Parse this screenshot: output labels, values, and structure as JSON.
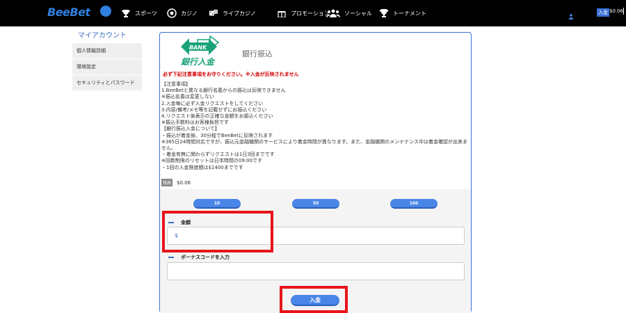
{
  "header": {
    "logo_text": "BeeBet",
    "nav": [
      {
        "label": "スポーツ",
        "icon": "trophy-icon"
      },
      {
        "label": "カジノ",
        "icon": "poker-chip-icon"
      },
      {
        "label": "ライブカジノ",
        "icon": "dice-icon"
      },
      {
        "label": "プロモーション",
        "icon": "gift-icon"
      },
      {
        "label": "ソーシャル",
        "icon": "users-icon"
      },
      {
        "label": "トーナメント",
        "icon": "cup-icon"
      }
    ],
    "balance_badge": "入金",
    "balance_value": "$0.06"
  },
  "sidebar": {
    "title": "マイアカウント",
    "items": [
      {
        "label": "個人情報詳細"
      },
      {
        "label": "環境設定"
      },
      {
        "label": "セキュリティとパスワード"
      }
    ]
  },
  "panel": {
    "bank_logo_text": "BANK",
    "bank_logo_sub": "銀行入金",
    "title": "銀行振込",
    "warning": "必ず下記注意事項をお守りください。※入金が反映されません",
    "notes": [
      "【注意事項】",
      "1.BeeBetと異なる銀行名義からの振込は反映できません",
      "※振込名義は変更しない",
      "2.入金毎に必ず入金リクエストをしてください",
      "3.内容/備考/メモ等を記載せずにお振込ください",
      "4.リクエスト後表示の正確な金額をお振込ください",
      "※振込手数料はお客様負担です",
      "【銀行振込入金について】",
      "・振込が着金後、30分程でBeeBetに反映されます",
      "※365日24時間対応ですが、振込元金融機関のサービスにより着金時間が異なります。また、金融機関のメンテナンス中は着金確認が出来ません。",
      "・着金有無に関わらずリクエストは1日3回までです",
      "※回数制限のリセットは日本時間の09:00です",
      "・1回の入金限度額は$1400までです"
    ],
    "balance_label": "残高",
    "balance_value": "$0.06",
    "quick_amounts": [
      "10",
      "50",
      "100"
    ],
    "amount_label": "金額",
    "amount_value": "$",
    "bonus_label": "ボーナスコードを入力",
    "bonus_value": "",
    "deposit_button": "入金"
  },
  "colors": {
    "accent": "#4a86e8",
    "highlight": "#e8141b",
    "warning": "#d40000"
  }
}
